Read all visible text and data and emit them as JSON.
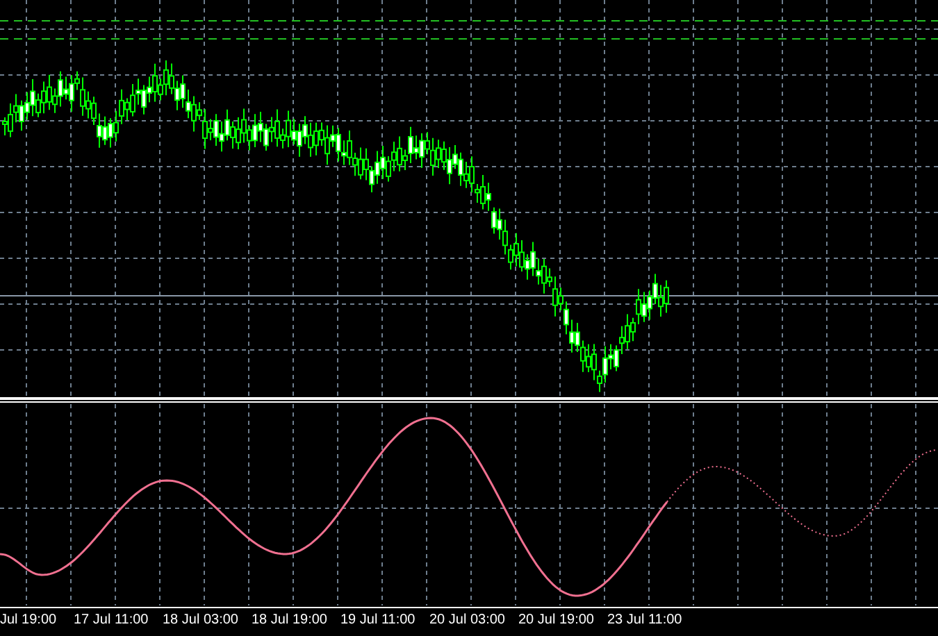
{
  "time_axis": {
    "labels": [
      "Jul 19:00",
      "17 Jul 11:00",
      "18 Jul 03:00",
      "18 Jul 19:00",
      "19 Jul 11:00",
      "20 Jul 03:00",
      "20 Jul 19:00",
      "23 Jul 11:00"
    ]
  }
}
